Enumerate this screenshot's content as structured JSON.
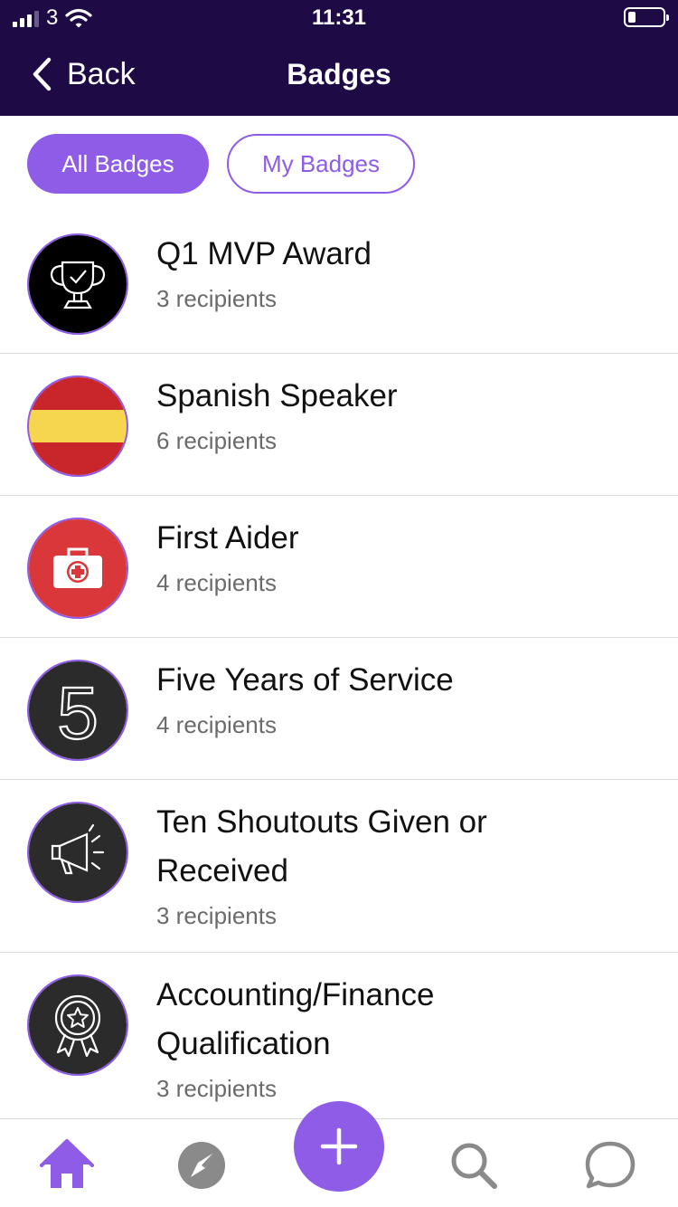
{
  "status_bar": {
    "carrier": "3",
    "time": "11:31"
  },
  "nav": {
    "back_label": "Back",
    "title": "Badges"
  },
  "filters": {
    "all": "All Badges",
    "mine": "My Badges"
  },
  "badges": [
    {
      "title": "Q1 MVP Award",
      "recipients": "3 recipients",
      "icon": "trophy-icon"
    },
    {
      "title": "Spanish Speaker",
      "recipients": "6 recipients",
      "icon": "spain-flag-icon"
    },
    {
      "title": "First Aider",
      "recipients": "4 recipients",
      "icon": "first-aid-kit-icon"
    },
    {
      "title": "Five Years of Service",
      "recipients": "4 recipients",
      "icon": "number-five-icon"
    },
    {
      "title": "Ten Shoutouts Given or Received",
      "recipients": "3 recipients",
      "icon": "megaphone-icon"
    },
    {
      "title": "Accounting/Finance Qualification",
      "recipients": "3 recipients",
      "icon": "rosette-star-icon"
    }
  ],
  "tabbar": {
    "items": [
      "home-icon",
      "compass-icon",
      "add-icon",
      "search-icon",
      "chat-icon"
    ]
  },
  "colors": {
    "header": "#1e0a45",
    "accent": "#8e5ce7"
  }
}
